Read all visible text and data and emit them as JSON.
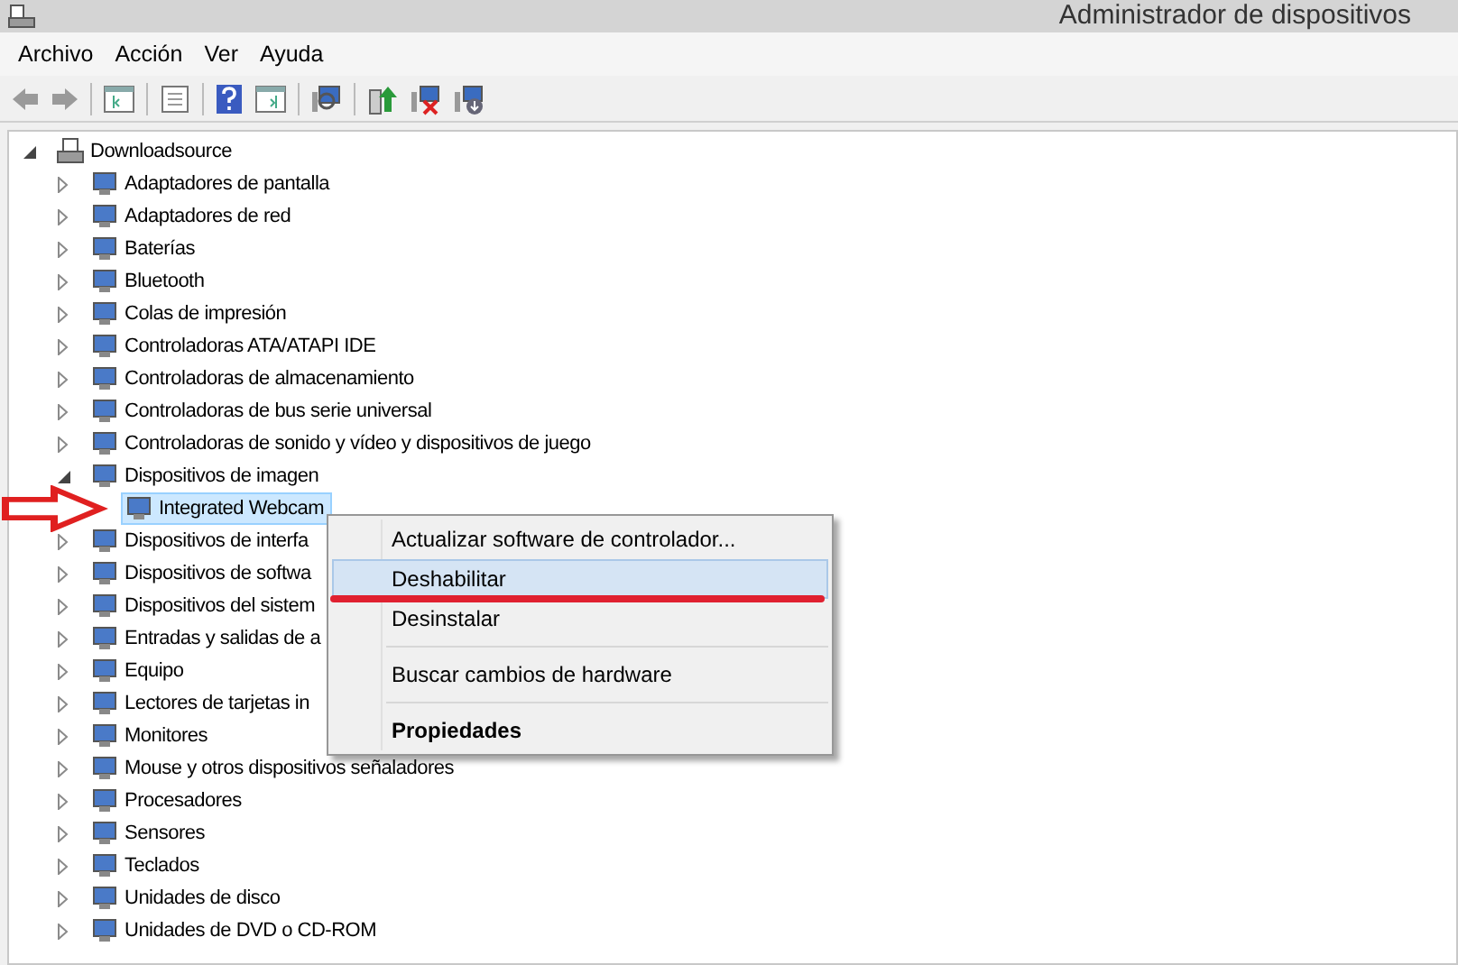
{
  "window": {
    "title": "Administrador de dispositivos"
  },
  "menu_bar": [
    "Archivo",
    "Acción",
    "Ver",
    "Ayuda"
  ],
  "tree": {
    "label": "Downloadsource",
    "expanded": true,
    "children": [
      {
        "label": "Adaptadores de pantalla",
        "expanded": false
      },
      {
        "label": "Adaptadores de red",
        "expanded": false
      },
      {
        "label": "Baterías",
        "expanded": false
      },
      {
        "label": "Bluetooth",
        "expanded": false
      },
      {
        "label": "Colas de impresión",
        "expanded": false
      },
      {
        "label": "Controladoras ATA/ATAPI IDE",
        "expanded": false
      },
      {
        "label": "Controladoras de almacenamiento",
        "expanded": false
      },
      {
        "label": "Controladoras de bus serie universal",
        "expanded": false
      },
      {
        "label": "Controladoras de sonido y vídeo y dispositivos de juego",
        "expanded": false
      },
      {
        "label": "Dispositivos de imagen",
        "expanded": true,
        "children": [
          {
            "label": "Integrated Webcam",
            "selected": true
          }
        ]
      },
      {
        "label": "Dispositivos de interfa",
        "expanded": false
      },
      {
        "label": "Dispositivos de softwa",
        "expanded": false
      },
      {
        "label": "Dispositivos del sistem",
        "expanded": false
      },
      {
        "label": "Entradas y salidas de a",
        "expanded": false
      },
      {
        "label": "Equipo",
        "expanded": false
      },
      {
        "label": "Lectores de tarjetas in",
        "expanded": false
      },
      {
        "label": "Monitores",
        "expanded": false
      },
      {
        "label": "Mouse y otros dispositivos señaladores",
        "expanded": false
      },
      {
        "label": "Procesadores",
        "expanded": false
      },
      {
        "label": "Sensores",
        "expanded": false
      },
      {
        "label": "Teclados",
        "expanded": false
      },
      {
        "label": "Unidades de disco",
        "expanded": false
      },
      {
        "label": "Unidades de DVD o CD-ROM",
        "expanded": false
      }
    ]
  },
  "context_menu": [
    {
      "kind": "item",
      "label": "Actualizar software de controlador...",
      "selected": false,
      "default": false
    },
    {
      "kind": "item",
      "label": "Deshabilitar",
      "selected": true,
      "default": false
    },
    {
      "kind": "item",
      "label": "Desinstalar",
      "selected": false,
      "default": false
    },
    {
      "kind": "separator"
    },
    {
      "kind": "item",
      "label": "Buscar cambios de hardware",
      "selected": false,
      "default": false
    },
    {
      "kind": "separator"
    },
    {
      "kind": "item",
      "label": "Propiedades",
      "selected": false,
      "default": true
    }
  ]
}
